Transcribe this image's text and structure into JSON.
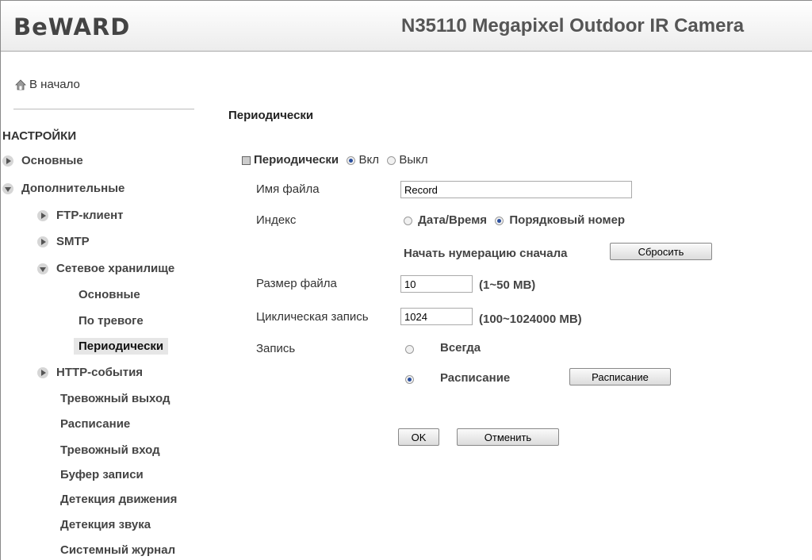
{
  "header": {
    "logo": "BeWARD",
    "model": "N35110 Megapixel Outdoor IR Camera"
  },
  "sidebar": {
    "home": "В начало",
    "section": "НАСТРОЙКИ",
    "items": [
      "Основные",
      "Дополнительные",
      "FTP-клиент",
      "SMTP",
      "Сетевое хранилище",
      "Основные",
      "По тревоге",
      "Периодически",
      "HTTP-события",
      "Тревожный выход",
      "Расписание",
      "Тревожный вход",
      "Буфер записи",
      "Детекция движения",
      "Детекция звука",
      "Системный журнал"
    ]
  },
  "main": {
    "title": "Периодически",
    "periodic": {
      "label": "Периодически",
      "on": "Вкл",
      "off": "Выкл",
      "selected": "on"
    },
    "filename": {
      "label": "Имя файла",
      "value": "Record"
    },
    "index": {
      "label": "Индекс",
      "opt_datetime": "Дата/Время",
      "opt_seq": "Порядковый номер",
      "selected": "seq",
      "restart_label": "Начать нумерацию сначала",
      "reset_button": "Сбросить"
    },
    "filesize": {
      "label": "Размер файла",
      "value": "10",
      "hint": "(1~50 MB)"
    },
    "cyclic": {
      "label": "Циклическая запись",
      "value": "1024",
      "hint": "(100~1024000 MB)"
    },
    "record": {
      "label": "Запись",
      "always": "Всегда",
      "schedule": "Расписание",
      "selected": "schedule",
      "schedule_button": "Расписание"
    },
    "ok_button": "OK",
    "cancel_button": "Отменить"
  }
}
